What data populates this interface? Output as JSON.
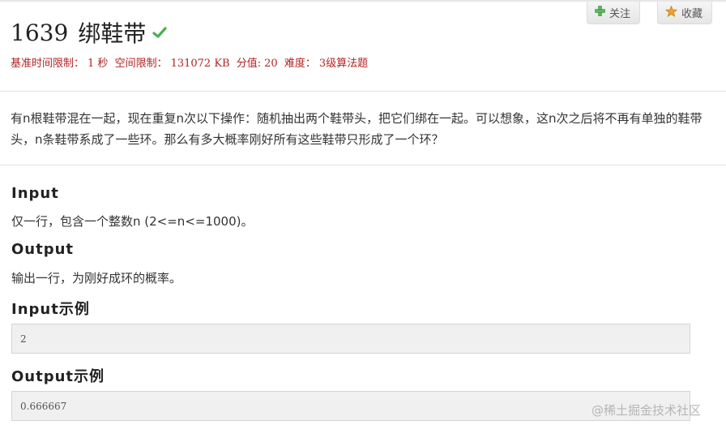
{
  "problem": {
    "id": "1639",
    "name": "绑鞋带",
    "meta": {
      "time_label": "基准时间限制：",
      "time_value": "1 秒",
      "mem_label": "空间限制：",
      "mem_value": "131072 KB",
      "score_label": "分值:",
      "score_value": "20",
      "diff_label": "难度：",
      "diff_value": "3级算法题"
    },
    "description": "有n根鞋带混在一起，现在重复n次以下操作：随机抽出两个鞋带头，把它们绑在一起。可以想象，这n次之后将不再有单独的鞋带头，n条鞋带系成了一些环。那么有多大概率刚好所有这些鞋带只形成了一个环？"
  },
  "actions": {
    "follow_label": "关注",
    "favorite_label": "收藏"
  },
  "sections": {
    "input_title": "Input",
    "input_text": "仅一行，包含一个整数n  (2<=n<=1000)。",
    "output_title": "Output",
    "output_text": "输出一行，为刚好成环的概率。",
    "input_example_title": "Input示例",
    "input_example": "2",
    "output_example_title": "Output示例",
    "output_example": "0.666667"
  },
  "watermark": "@稀土掘金技术社区",
  "colors": {
    "meta_red": "#b22222",
    "check_green": "#4caf50",
    "plus_green": "#5cb85c",
    "star_orange": "#f0a030"
  }
}
